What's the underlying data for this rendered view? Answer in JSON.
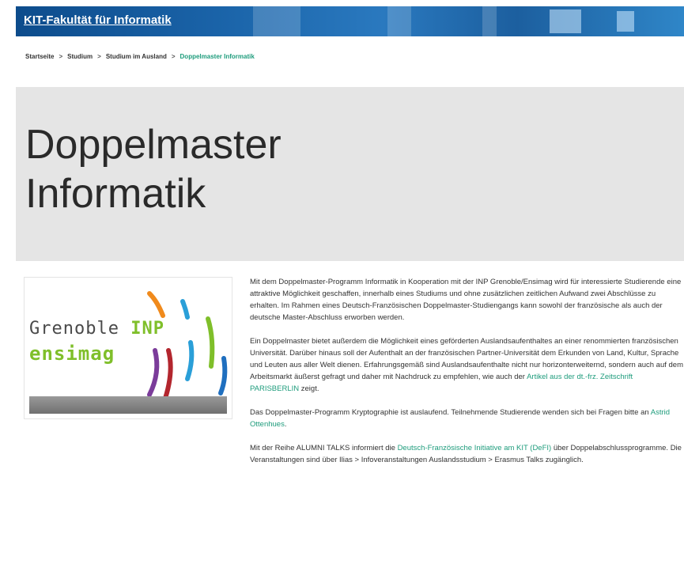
{
  "header": {
    "title": "KIT-Fakultät für Informatik"
  },
  "breadcrumb": {
    "items": [
      "Startseite",
      "Studium",
      "Studium im Ausland"
    ],
    "current": "Doppelmaster Informatik",
    "separator": ">"
  },
  "hero": {
    "title_line1": "Doppelmaster",
    "title_line2": "Informatik"
  },
  "logo": {
    "line1_a": "Grenoble ",
    "line1_b": "INP",
    "line2": "ensimag"
  },
  "content": {
    "p1": "Mit dem Doppelmaster-Programm Informatik in Kooperation mit der INP Grenoble/Ensimag wird für interessierte Studierende eine attraktive Möglichkeit geschaffen, innerhalb eines Studiums und ohne zusätzlichen zeitlichen Aufwand zwei Abschlüsse zu erhalten. Im Rahmen eines Deutsch-Französischen Doppelmaster-Studiengangs kann sowohl der französische als auch der deutsche Master-Abschluss erworben werden.",
    "p2_text": "Ein Doppelmaster bietet außerdem die Möglichkeit eines geförderten Auslandsaufenthaltes an einer renommierten französischen Universität. Darüber hinaus soll der Aufenthalt an der französischen Partner-Universität dem Erkunden von Land, Kultur, Sprache und Leuten aus aller Welt dienen. Erfahrungsgemäß sind Auslandsaufenthalte nicht nur horizonterweiternd, sondern auch auf dem Arbeitsmarkt äußerst gefragt und daher mit Nachdruck zu empfehlen, wie auch der ",
    "p2_link": "Artikel aus der dt.-frz. Zeitschrift PARISBERLIN",
    "p2_end": " zeigt.",
    "p3_text": "Das Doppelmaster-Programm Kryptographie ist auslaufend. Teilnehmende Studierende wenden sich bei Fragen bitte an ",
    "p3_link": "Astrid Ottenhues",
    "p3_end": ".",
    "p4_text": "Mit der Reihe ALUMNI TALKS informiert die ",
    "p4_link": "Deutsch-Französische Initiative am KIT (DeFI)",
    "p4_end": " über Doppelabschlussprogramme. Die Veranstaltungen sind über Ilias > Infoveranstaltungen Auslandsstudium > Erasmus Talks zugänglich."
  },
  "colors": {
    "link": "#1e9c7c",
    "banner": "#1a63a8",
    "hero_bg": "#e5e5e5",
    "logo_green": "#7fbf2a"
  }
}
